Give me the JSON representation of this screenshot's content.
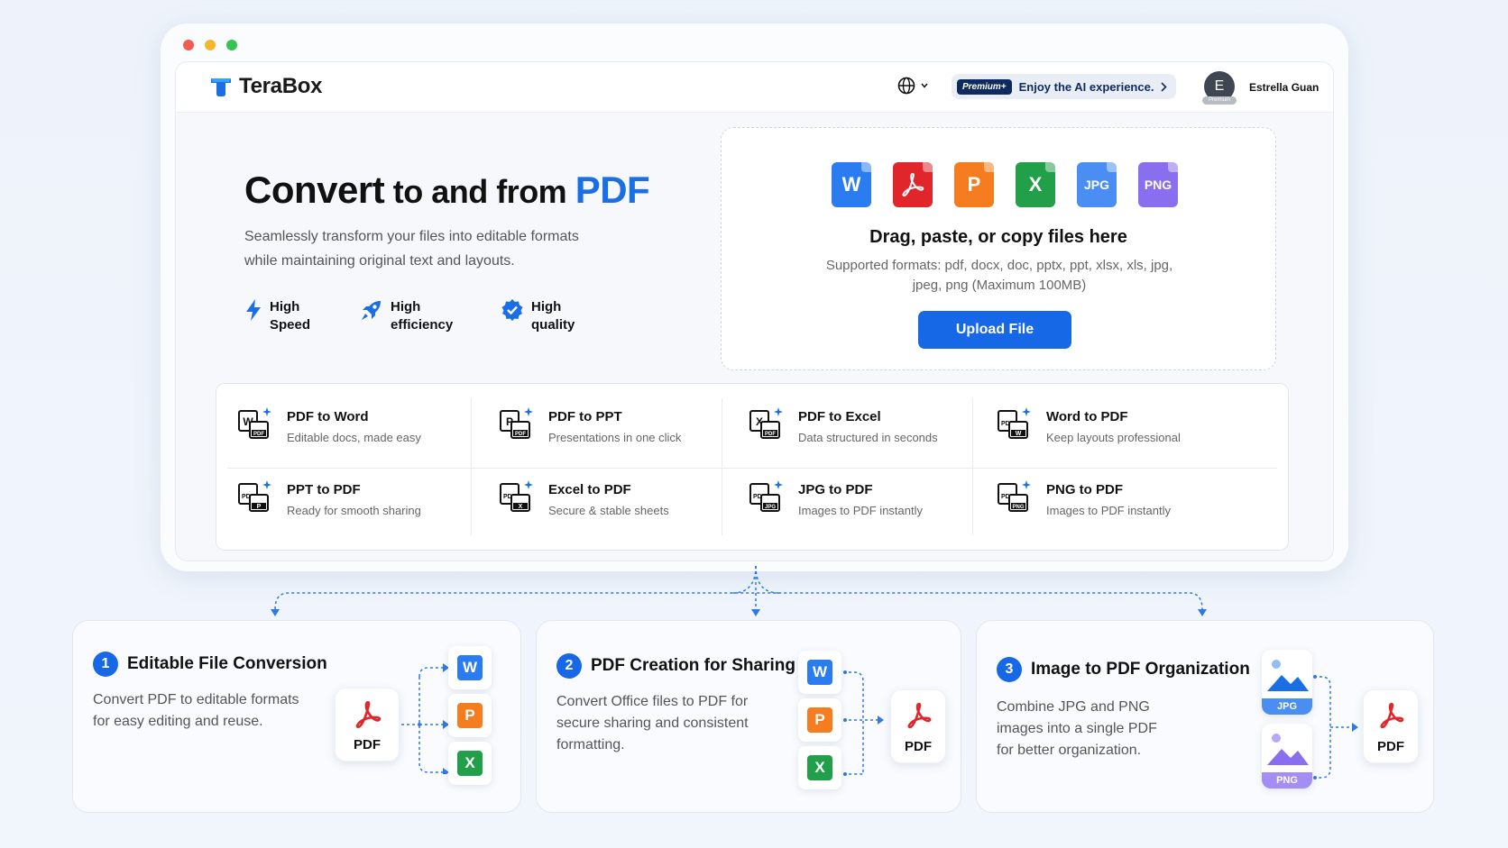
{
  "colors": {
    "accent": "#1668e6",
    "pdf_red": "#e0262b",
    "word_blue": "#2b7cf0",
    "ppt_orange": "#f57c1f",
    "excel_green": "#21a049",
    "jpg_blue": "#4b8ef3",
    "png_purple": "#8a6ef0"
  },
  "window": {
    "traffic_lights": [
      "#f45a50",
      "#f6b62c",
      "#34c451"
    ]
  },
  "topbar": {
    "logo_text": "TeraBox",
    "language_icon": "globe-icon",
    "premium_badge": "Premium+",
    "premium_text": "Enjoy the AI experience.",
    "avatar_initial": "E",
    "avatar_badge": "Premium",
    "username": "Estrella Guan"
  },
  "hero": {
    "title_part1": "Convert",
    "title_part2": " to ",
    "title_part3": "and from ",
    "title_part4": "PDF",
    "subtitle": "Seamlessly transform your files into editable formats while maintaining original text and layouts.",
    "features": [
      {
        "icon": "lightning-icon",
        "line1": "High",
        "line2": "Speed"
      },
      {
        "icon": "rocket-icon",
        "line1": "High",
        "line2": "efficiency"
      },
      {
        "icon": "verified-badge-icon",
        "line1": "High",
        "line2": "quality"
      }
    ]
  },
  "upload": {
    "file_icons": [
      {
        "name": "word-file-icon",
        "label": "W",
        "color": "#2b7cf0"
      },
      {
        "name": "pdf-file-icon",
        "label": "",
        "color": "#e0262b"
      },
      {
        "name": "ppt-file-icon",
        "label": "P",
        "color": "#f57c1f"
      },
      {
        "name": "excel-file-icon",
        "label": "X",
        "color": "#21a049"
      },
      {
        "name": "jpg-file-icon",
        "label": "JPG",
        "color": "#4b8ef3"
      },
      {
        "name": "png-file-icon",
        "label": "PNG",
        "color": "#8a6ef0"
      }
    ],
    "title": "Drag, paste, or copy files here",
    "supported": "Supported formats: pdf, docx, doc, pptx, ppt, xlsx, xls, jpg, jpeg, png (Maximum 100MB)",
    "button": "Upload File"
  },
  "tools": [
    {
      "title": "PDF to Word",
      "desc": "Editable docs, made easy",
      "from": "W",
      "to": "PDF"
    },
    {
      "title": "PDF to PPT",
      "desc": "Presentations in one click",
      "from": "P",
      "to": "PDF"
    },
    {
      "title": "PDF to Excel",
      "desc": "Data structured in seconds",
      "from": "X",
      "to": "PDF"
    },
    {
      "title": "Word to PDF",
      "desc": "Keep layouts professional",
      "from": "PDF",
      "to": "W"
    },
    {
      "title": "PPT to PDF",
      "desc": "Ready for smooth sharing",
      "from": "PDF",
      "to": "P"
    },
    {
      "title": "Excel to PDF",
      "desc": "Secure & stable sheets",
      "from": "PDF",
      "to": "X"
    },
    {
      "title": "JPG to PDF",
      "desc": "Images to PDF instantly",
      "from": "PDF",
      "to": "JPG"
    },
    {
      "title": "PNG to PDF",
      "desc": "Images to PDF instantly",
      "from": "PDF",
      "to": "PNG"
    }
  ],
  "cards": [
    {
      "num": "1",
      "title": "Editable File Conversion",
      "desc": "Convert PDF to editable formats for easy editing and reuse."
    },
    {
      "num": "2",
      "title": "PDF Creation for Sharing",
      "desc": "Convert Office files to PDF for secure sharing and consistent formatting."
    },
    {
      "num": "3",
      "title": "Image to PDF Organization",
      "desc": "Combine JPG and PNG images into a single PDF for better organization."
    }
  ],
  "tile_labels": {
    "pdf": "PDF",
    "word": "W",
    "ppt": "P",
    "excel": "X",
    "jpg": "JPG",
    "png": "PNG"
  }
}
